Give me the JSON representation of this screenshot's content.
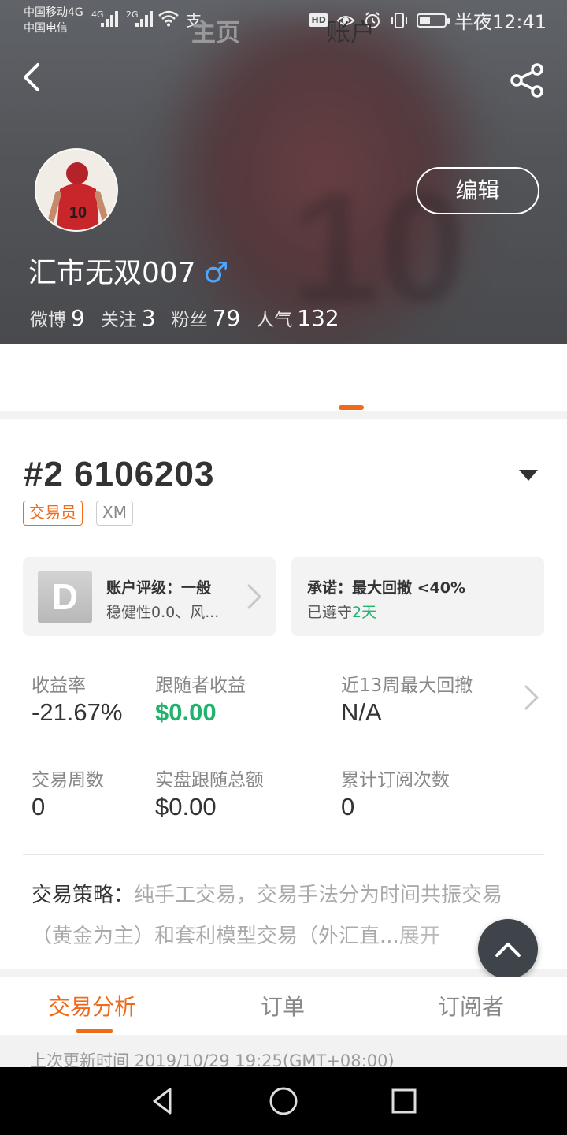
{
  "status_bar": {
    "carrier1": "中国移动4G",
    "carrier2": "中国电信",
    "sig1": "4G",
    "sig2": "2G",
    "hd": "HD",
    "time": "半夜12:41"
  },
  "profile": {
    "username": "汇市无双007",
    "gender_symbol": "♂",
    "edit_label": "编辑",
    "avatar_number": "10",
    "stats": [
      {
        "label": "微博",
        "value": "9"
      },
      {
        "label": "关注",
        "value": "3"
      },
      {
        "label": "粉丝",
        "value": "79"
      },
      {
        "label": "人气",
        "value": "132"
      }
    ]
  },
  "top_tabs": [
    {
      "label": "主页",
      "active": false
    },
    {
      "label": "账户",
      "active": true
    }
  ],
  "account": {
    "id": "#2 6106203",
    "tags": [
      "交易员",
      "XM"
    ],
    "rating": {
      "badge": "D",
      "title": "账户评级：一般",
      "subtitle": "稳健性0.0、风..."
    },
    "promise": {
      "title": "承诺：最大回撤 <40%",
      "sub_prefix": "已遵守",
      "sub_days": "2天"
    },
    "metrics": [
      {
        "label": "收益率",
        "value": "-21.67%"
      },
      {
        "label": "跟随者收益",
        "value": "$0.00"
      },
      {
        "label": "近13周最大回撤",
        "value": "N/A"
      },
      {
        "label": "交易周数",
        "value": "0"
      },
      {
        "label": "实盘跟随总额",
        "value": "$0.00"
      },
      {
        "label": "累计订阅次数",
        "value": "0"
      }
    ],
    "strategy": {
      "label": "交易策略：",
      "text": "纯手工交易，交易手法分为时间共振交易（黄金为主）和套利模型交易（外汇直...",
      "more": "展开"
    }
  },
  "bottom_tabs": [
    {
      "label": "交易分析",
      "active": true
    },
    {
      "label": "订单",
      "active": false
    },
    {
      "label": "订阅者",
      "active": false
    }
  ],
  "last_update": "上次更新时间 2019/10/29 19:25(GMT+08:00)",
  "colors": {
    "accent": "#f06a1a",
    "positive": "#20b36e",
    "gender": "#4ea7ff",
    "fab": "#3f434a"
  },
  "icons": [
    "back-arrow-icon",
    "share-icon",
    "dropdown-triangle-icon",
    "chevron-right-icon",
    "arrow-up-icon",
    "nav-back-icon",
    "nav-home-icon",
    "nav-recents-icon"
  ]
}
